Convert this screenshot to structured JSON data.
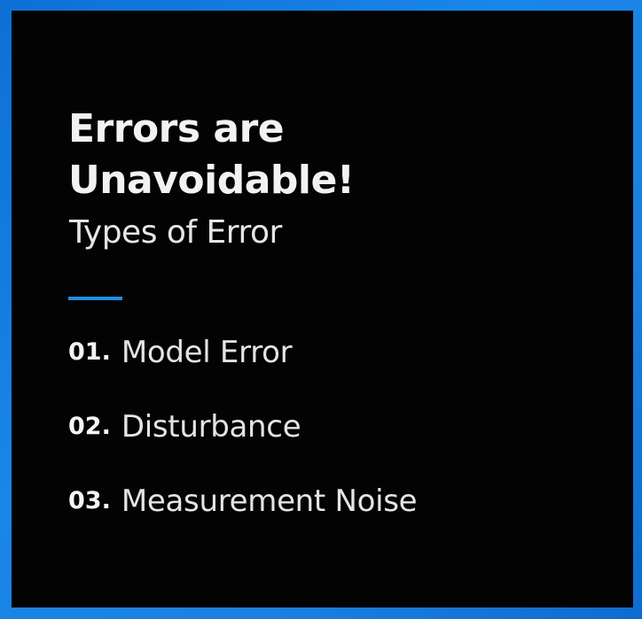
{
  "slide": {
    "title_line1": "Errors are",
    "title_line2": "Unavoidable!",
    "subtitle": "Types of Error",
    "accent_color": "#1f8fe3",
    "border_color": "#1a86e8",
    "background_color": "#030303",
    "items": [
      {
        "number": "01.",
        "label": "Model Error"
      },
      {
        "number": "02.",
        "label": "Disturbance"
      },
      {
        "number": "03.",
        "label": "Measurement Noise"
      }
    ]
  }
}
